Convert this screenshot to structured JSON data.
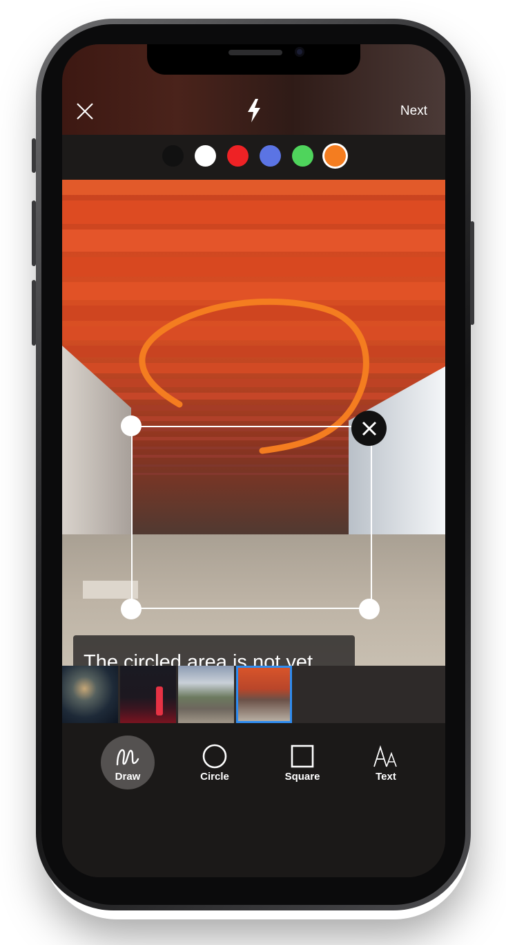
{
  "header": {
    "close_icon": "close-icon",
    "flash_icon": "flash-icon",
    "next_label": "Next"
  },
  "palette": {
    "colors": [
      "#111111",
      "#ffffff",
      "#ee2225",
      "#5b74e4",
      "#4fd45c",
      "#f47d20"
    ],
    "selected_color": "#f47d20"
  },
  "annotation": {
    "stroke_color": "#f47d20",
    "caption": "The circled area is not yet inspected"
  },
  "thumbnails": {
    "count": 4,
    "selected_index": 3
  },
  "toolbar": {
    "tools": [
      {
        "label": "Draw",
        "icon": "draw-icon",
        "active": true
      },
      {
        "label": "Circle",
        "icon": "circle-icon",
        "active": false
      },
      {
        "label": "Square",
        "icon": "square-icon",
        "active": false
      },
      {
        "label": "Text",
        "icon": "text-icon",
        "active": false
      }
    ]
  }
}
